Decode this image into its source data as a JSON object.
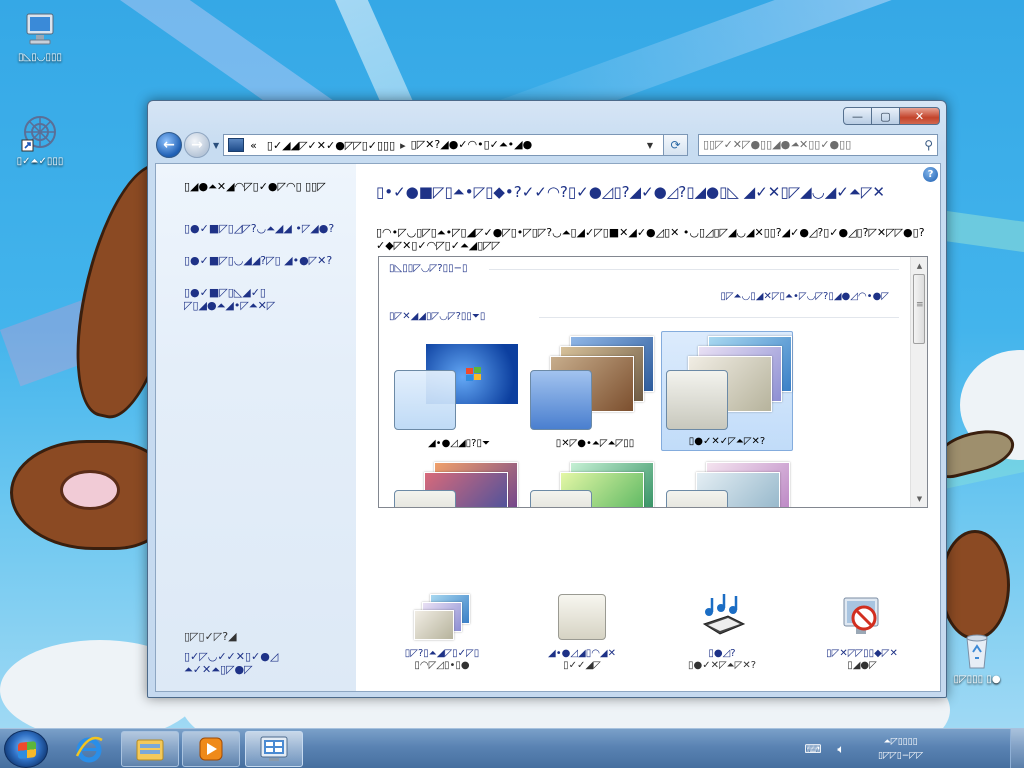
{
  "desktop": {
    "icons": [
      {
        "name": "computer",
        "label": "▯◺▯◡▯▯▯"
      },
      {
        "name": "shortcut",
        "label": "▯✓⏶✓▯▯▯"
      },
      {
        "name": "recycle-bin",
        "label": "▯◸▯▯▯ ▯●"
      }
    ]
  },
  "window": {
    "caption": {
      "minimize": "—",
      "maximize": "▢",
      "close": "✕"
    },
    "address": {
      "crumb1": "▯✓◢◢◸✓✕✓●◸◸▯✓▯▯▯",
      "crumb2": "▯◸✕?◢●✓◠•▯✓⏶•◢●"
    },
    "search_placeholder": "▯▯◸✓✕◸●▯▯◢●⏶✕▯▯✓●▯▯",
    "left_pane": {
      "home_link": "▯◢●⏶✕◢◠◸▯✓●◸◠▯ ▯▯◸",
      "links": [
        "▯●✓■◸▯◿◸?◡⏶◢◢ •◸◢●?",
        "▯●✓■◸▯◡◢◢?◸▯ ◢•●◸✕?",
        "▯●✓■◸▯◺◢✓▯ ◸▯◢●⏶◢•◸⏶✕◸"
      ],
      "see_also": "▯◸▯✓◸?◢",
      "see_also_links": [
        "▯✓◸◡✓✓✕▯✓●◿",
        "⏶✓✕⏶▯◸●◸"
      ]
    },
    "right_pane": {
      "title": "▯•✓●■◸▯⏶•◸▯◆•?✓✓◠?▯✓●◿▯?◢✓●◿?▯◢●▯◺ ◢✓✕▯◸◢◡◢✓⏶◸✕",
      "description": "▯◠•◸◡▯◸▯⏶•◸▯◢◸✓●◸▯•◸▯◸?◡⏶▯◢✓◸▯■✕◢✓●◿▯✕ •◡▯◿▯◸◢◡◢✕▯▯?◢✓●◿?▯✓●◿▯?◸✕◸◸●▯?✓◆◸✕▯✓◠◸▯✓⏶◢▯◸◸",
      "groups": {
        "my_themes": "▯◺▯▯◸◡◸?▯▯−▯",
        "save_theme": "▯◸⏶◡▯◢✕◸▯⏶•◸◡◸?▯◢●◿◠•●◸",
        "aero_themes": "▯◸✕◢◢▯◸◡◸?▯▯⏷▯"
      },
      "themes": [
        {
          "name": "windows-7",
          "label": "◢•●◿◢▯?▯⏷"
        },
        {
          "name": "architecture",
          "label": "▯✕◸●•⏶◸⏶◸▯▯"
        },
        {
          "name": "characters",
          "label": "▯●✓✕✓◸⏶◸✕?",
          "selected": true
        }
      ],
      "bottom_items": [
        {
          "name": "desktop-background",
          "label": "▯◸?▯⏶◢◸▯✓◸▯",
          "sub": "▯◠◸◿▯•▯●"
        },
        {
          "name": "window-color",
          "label": "◢•●◿◢▯◠◢✕",
          "sub": "▯✓✓◢◸"
        },
        {
          "name": "sounds",
          "label": "▯●◿?",
          "sub": "▯●✓✕◸⏶◸✕?"
        },
        {
          "name": "screen-saver",
          "label": "▯◸✕◸◸▯▯◆◸✕",
          "sub": "▯◢●◸"
        }
      ],
      "shield_text": "▯✕◢✓◠◸?▯◢◢◡◢✕✓◠◸?▯◢◸▯⏶●◸✓●?◢✓✕◸●◸◺▯◢●◿ ◢•◸✕▯▯✕◢◿◿◿◸?"
    }
  },
  "taskbar": {
    "clock_time": "⏶◸▯▯▯▯",
    "clock_date": "▯◸◸▯−◸◸"
  },
  "colors": {
    "link": "#1e3287",
    "selection_border": "#84acdd",
    "taskbar": "#5a83b3",
    "desktop_sky": "#43b4ec"
  }
}
